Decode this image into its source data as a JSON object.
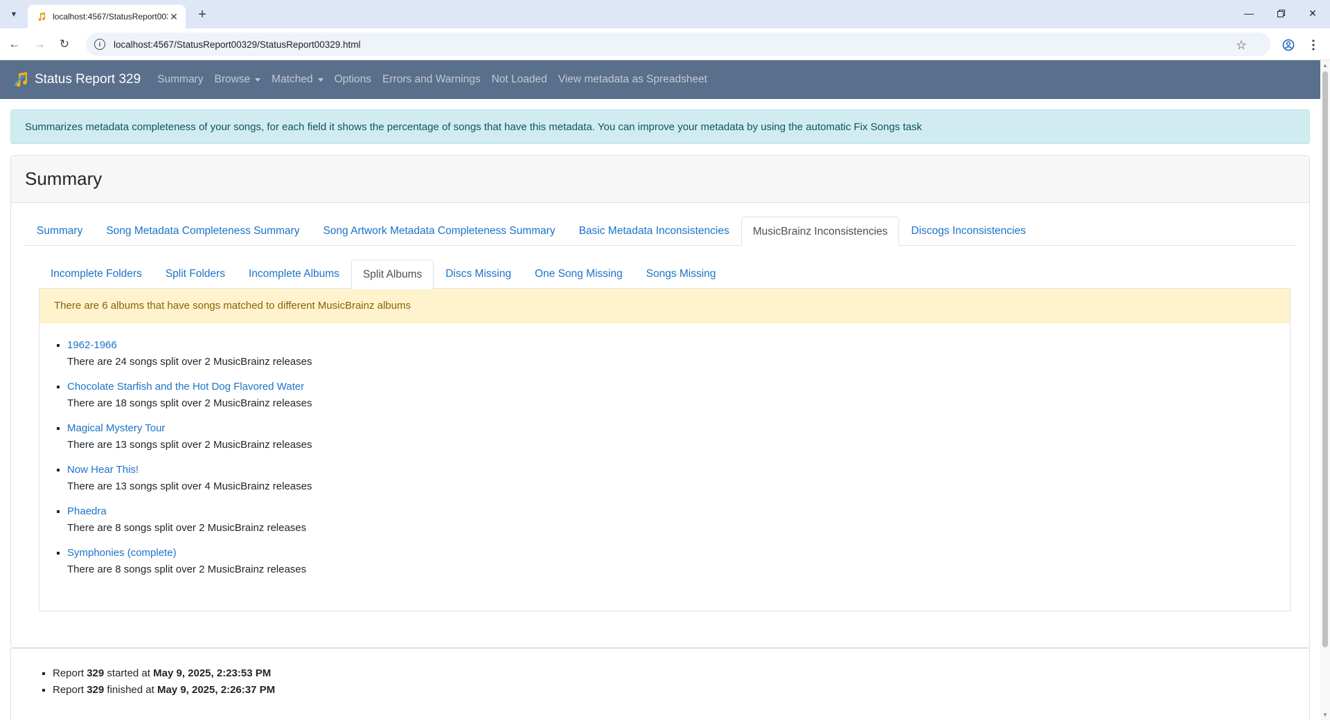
{
  "browser": {
    "tab_title": "localhost:4567/StatusReport003",
    "url": "localhost:4567/StatusReport00329/StatusReport00329.html"
  },
  "navbar": {
    "brand": "Status Report 329",
    "links": [
      "Summary",
      "Browse",
      "Matched",
      "Options",
      "Errors and Warnings",
      "Not Loaded",
      "View metadata as Spreadsheet"
    ]
  },
  "info_alert": "Summarizes metadata completeness of your songs, for each field it shows the percentage of songs that have this metadata. You can improve your metadata by using the automatic Fix Songs task",
  "card": {
    "title": "Summary",
    "tabs": [
      "Summary",
      "Song Metadata Completeness Summary",
      "Song Artwork Metadata Completeness Summary",
      "Basic Metadata Inconsistencies",
      "MusicBrainz Inconsistencies",
      "Discogs Inconsistencies"
    ],
    "active_tab": "MusicBrainz Inconsistencies",
    "subtabs": [
      "Incomplete Folders",
      "Split Folders",
      "Incomplete Albums",
      "Split Albums",
      "Discs Missing",
      "One Song Missing",
      "Songs Missing"
    ],
    "active_subtab": "Split Albums",
    "warning": "There are 6 albums that have songs matched to different MusicBrainz albums",
    "albums": [
      {
        "title": "1962-1966",
        "desc": "There are 24 songs split over 2 MusicBrainz releases"
      },
      {
        "title": "Chocolate Starfish and the Hot Dog Flavored Water",
        "desc": "There are 18 songs split over 2 MusicBrainz releases"
      },
      {
        "title": "Magical Mystery Tour",
        "desc": "There are 13 songs split over 2 MusicBrainz releases"
      },
      {
        "title": "Now Hear This!",
        "desc": "There are 13 songs split over 4 MusicBrainz releases"
      },
      {
        "title": "Phaedra",
        "desc": "There are 8 songs split over 2 MusicBrainz releases"
      },
      {
        "title": "Symphonies (complete)",
        "desc": "There are 8 songs split over 2 MusicBrainz releases"
      }
    ]
  },
  "footer": {
    "report_label": "Report",
    "report_number": "329",
    "started_text": "started at",
    "started_at": "May 9, 2025, 2:23:53 PM",
    "finished_text": "finished at",
    "finished_at": "May 9, 2025, 2:26:37 PM"
  }
}
